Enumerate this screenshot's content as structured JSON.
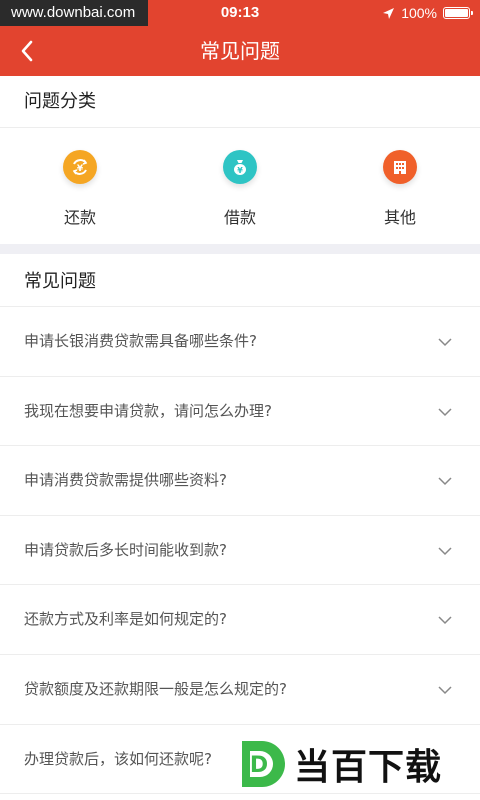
{
  "status": {
    "watermark": "www.downbai.com",
    "time": "09:13",
    "battery": "100%"
  },
  "nav": {
    "title": "常见问题"
  },
  "categories": {
    "title": "问题分类",
    "items": [
      {
        "label": "还款",
        "color": "#f5a623",
        "icon": "yen-cycle-icon"
      },
      {
        "label": "借款",
        "color": "#2ec4c4",
        "icon": "money-bag-icon"
      },
      {
        "label": "其他",
        "color": "#f0602a",
        "icon": "building-icon"
      }
    ]
  },
  "faq": {
    "title": "常见问题",
    "items": [
      "申请长银消费贷款需具备哪些条件?",
      "我现在想要申请贷款，请问怎么办理?",
      "申请消费贷款需提供哪些资料?",
      "申请贷款后多长时间能收到款?",
      "还款方式及利率是如何规定的?",
      "贷款额度及还款期限一般是怎么规定的?",
      "办理贷款后，该如何还款呢?"
    ]
  },
  "brand": {
    "text": "当百下载",
    "letter": "D"
  },
  "colors": {
    "primary": "#e2442f"
  }
}
